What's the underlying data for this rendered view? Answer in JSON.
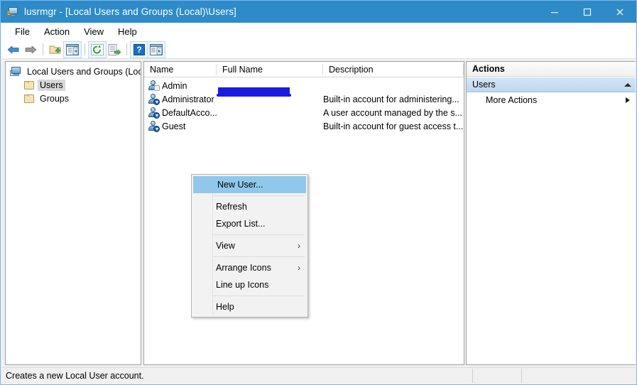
{
  "window": {
    "title": "lusrmgr - [Local Users and Groups (Local)\\Users]",
    "icon": "mmc-console-icon",
    "minimize_label": "–",
    "maximize_label": "□",
    "close_label": "✕"
  },
  "menubar": {
    "items": [
      {
        "label": "File"
      },
      {
        "label": "Action"
      },
      {
        "label": "View"
      },
      {
        "label": "Help"
      }
    ]
  },
  "toolbar": {
    "buttons": [
      {
        "name": "back-icon",
        "tip": "Back"
      },
      {
        "name": "forward-icon",
        "tip": "Forward"
      },
      {
        "name": "up-folder-icon",
        "tip": "Up One Level"
      },
      {
        "name": "show-hide-tree-icon",
        "tip": "Show/Hide Console Tree"
      },
      {
        "name": "refresh-icon",
        "tip": "Refresh"
      },
      {
        "name": "export-list-icon",
        "tip": "Export List"
      },
      {
        "name": "help-icon",
        "tip": "Help"
      },
      {
        "name": "show-hide-action-pane-icon",
        "tip": "Show/Hide Action Pane"
      }
    ]
  },
  "tree": {
    "root": {
      "label": "Local Users and Groups (Local)",
      "icon": "computer-icon"
    },
    "children": [
      {
        "label": "Users",
        "icon": "folder-icon",
        "selected": true
      },
      {
        "label": "Groups",
        "icon": "folder-icon",
        "selected": false
      }
    ]
  },
  "list": {
    "columns": [
      {
        "label": "Name"
      },
      {
        "label": "Full Name"
      },
      {
        "label": "Description"
      }
    ],
    "rows": [
      {
        "name": "Admin",
        "icon": "user-icon",
        "full_name": "",
        "full_name_redacted": true,
        "description": ""
      },
      {
        "name": "Administrator",
        "icon": "user-disabled-icon",
        "full_name": "",
        "full_name_redacted": false,
        "description": "Built-in account for administering..."
      },
      {
        "name": "DefaultAcco...",
        "icon": "user-disabled-icon",
        "full_name": "",
        "full_name_redacted": false,
        "description": "A user account managed by the s..."
      },
      {
        "name": "Guest",
        "icon": "user-disabled-icon",
        "full_name": "",
        "full_name_redacted": false,
        "description": "Built-in account for guest access t..."
      }
    ]
  },
  "actions": {
    "title": "Actions",
    "group_label": "Users",
    "group_collapse_icon": "caret-up-icon",
    "items": [
      {
        "label": "More Actions",
        "submenu_icon": "caret-right-icon"
      }
    ]
  },
  "context_menu": {
    "items": [
      {
        "label": "New User...",
        "highlighted": true,
        "submenu": ""
      },
      {
        "separator": true
      },
      {
        "label": "Refresh",
        "highlighted": false,
        "submenu": ""
      },
      {
        "label": "Export List...",
        "highlighted": false,
        "submenu": ""
      },
      {
        "separator": true
      },
      {
        "label": "View",
        "highlighted": false,
        "submenu": "›"
      },
      {
        "separator": true
      },
      {
        "label": "Arrange Icons",
        "highlighted": false,
        "submenu": "›"
      },
      {
        "label": "Line up Icons",
        "highlighted": false,
        "submenu": ""
      },
      {
        "separator": true
      },
      {
        "label": "Help",
        "highlighted": false,
        "submenu": ""
      }
    ]
  },
  "statusbar": {
    "text": "Creates a new Local User account."
  },
  "colors": {
    "titlebar": "#2e8bc8",
    "menu_highlight": "#8fc8ea",
    "actions_group": "#c6dcf1",
    "redaction": "#1a1ae2",
    "window_bg": "#f0f0f0"
  }
}
